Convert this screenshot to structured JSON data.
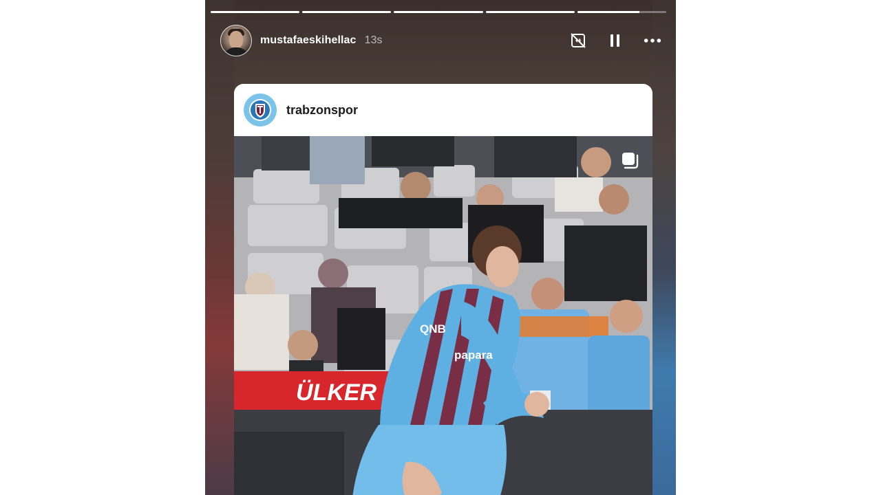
{
  "story": {
    "segments": [
      1,
      1,
      1,
      1,
      0.7
    ],
    "username": "mustafaeskihellac",
    "time_ago": "13s",
    "icons": {
      "avatar": "user-avatar",
      "mute": "sound-off-icon",
      "pause": "pause-icon",
      "more": "more-options-icon"
    }
  },
  "shared_post": {
    "account": "trabzonspor",
    "icons": {
      "avatar": "trabzonspor-crest-icon",
      "multi": "multi-photo-icon"
    },
    "photo": {
      "ad_board_text": "ÜLKER",
      "sponsor_text": "QNB",
      "sponsor_text_2": "papara"
    }
  }
}
